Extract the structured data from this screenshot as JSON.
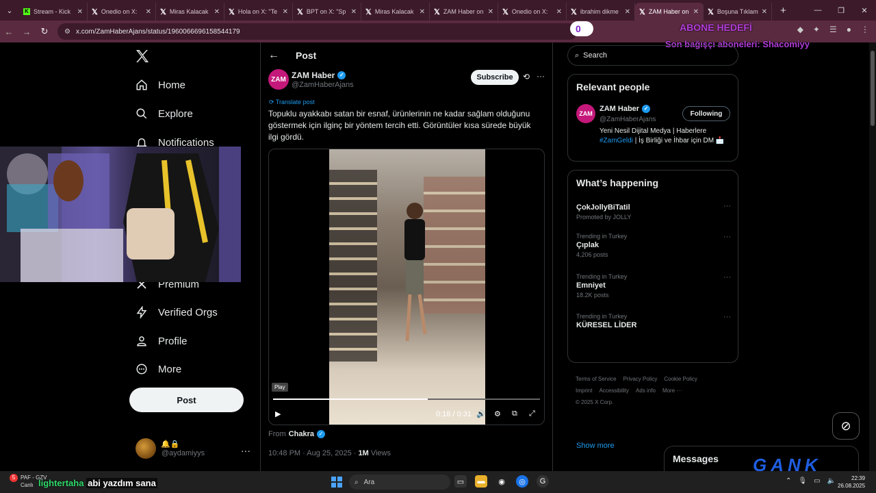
{
  "browser": {
    "tabs": [
      {
        "label": "Stream - Kick",
        "icon": "kick-icon"
      },
      {
        "label": "Onedio on X:",
        "icon": "x-icon"
      },
      {
        "label": "Miras Kalacak",
        "icon": "x-icon"
      },
      {
        "label": "Hola on X: \"Te",
        "icon": "x-icon"
      },
      {
        "label": "BPT on X: \"Sp",
        "icon": "x-icon"
      },
      {
        "label": "Miras Kalacak",
        "icon": "x-icon"
      },
      {
        "label": "ZAM Haber on",
        "icon": "x-icon"
      },
      {
        "label": "Onedio on X:",
        "icon": "x-icon"
      },
      {
        "label": "ibrahim dikme",
        "icon": "x-icon"
      },
      {
        "label": "ZAM Haber on",
        "icon": "x-icon",
        "active": true
      },
      {
        "label": "Boşuna Tıklam",
        "icon": "x-icon"
      }
    ],
    "url": "x.com/ZamHaberAjans/status/1960066696158544179"
  },
  "stream_overlay": {
    "counter": "0",
    "goal_text": "ABONE HEDEFİ",
    "last_donor": "Son bağışçı aboneleri: Shacomiyy",
    "chat_nick": "lightertaha",
    "chat_msg": "abi yazdım sana",
    "brand": "GANK"
  },
  "nav": {
    "items": [
      {
        "label": "Home",
        "icon": "home-icon"
      },
      {
        "label": "Explore",
        "icon": "search-icon"
      },
      {
        "label": "Notifications",
        "icon": "bell-icon"
      },
      {
        "label": "Premium",
        "icon": "x-icon"
      },
      {
        "label": "Verified Orgs",
        "icon": "lightning-icon"
      },
      {
        "label": "Profile",
        "icon": "person-icon"
      },
      {
        "label": "More",
        "icon": "more-circle-icon"
      }
    ],
    "post_button": "Post",
    "account": {
      "handle": "@aydamiyys",
      "emojis": "🔔🔒"
    }
  },
  "post": {
    "header_title": "Post",
    "author_name": "ZAM Haber",
    "author_handle": "@ZamHaberAjans",
    "avatar_text": "ZAM",
    "subscribe": "Subscribe",
    "translate": "Translate post",
    "text": "Topuklu ayakkabı satan bir esnaf, ürünlerinin ne kadar sağlam olduğunu göstermek için ilginç bir yöntem tercih etti. Görüntüler kısa sürede büyük ilgi gördü.",
    "video": {
      "tooltip": "Play",
      "time": "0:18 / 0:31",
      "progress": 0.58
    },
    "from_label": "From",
    "from_source": "Chakra",
    "timestamp": "10:48 PM · Aug 25, 2025 ·",
    "views_count": "1M",
    "views_label": "Views"
  },
  "sidebar": {
    "search_placeholder": "Search",
    "relevant_title": "Relevant people",
    "relevant": {
      "name": "ZAM Haber",
      "handle": "@ZamHaberAjans",
      "avatar_text": "ZAM",
      "follow": "Following",
      "bio_a": "Yeni Nesil Dijital Medya | Haberlere",
      "bio_tag": "#ZamGeldi",
      "bio_b": "| İş Birliği ve İhbar için DM",
      "bio_emoji": "📩"
    },
    "happening_title": "What’s happening",
    "trends": [
      {
        "context": "",
        "name": "ÇokJollyBiTatil",
        "count": "Promoted by JOLLY"
      },
      {
        "context": "Trending in Turkey",
        "name": "Çıplak",
        "count": "4,206 posts"
      },
      {
        "context": "Trending in Turkey",
        "name": "Emniyet",
        "count": "18.2K posts"
      },
      {
        "context": "Trending in Turkey",
        "name": "KÜRESEL LİDER",
        "count": ""
      }
    ],
    "show_more": "Show more",
    "footer": [
      "Terms of Service",
      "Privacy Policy",
      "Cookie Policy",
      "Imprint",
      "Accessibility",
      "Ads info",
      "More ···",
      "© 2025 X Corp."
    ],
    "messages": "Messages"
  },
  "taskbar": {
    "left_a": "PAF - GZV",
    "left_b": "Canlı",
    "left_badge": "5",
    "search": "Ara",
    "time": "22:39",
    "date": "26.08.2025"
  }
}
